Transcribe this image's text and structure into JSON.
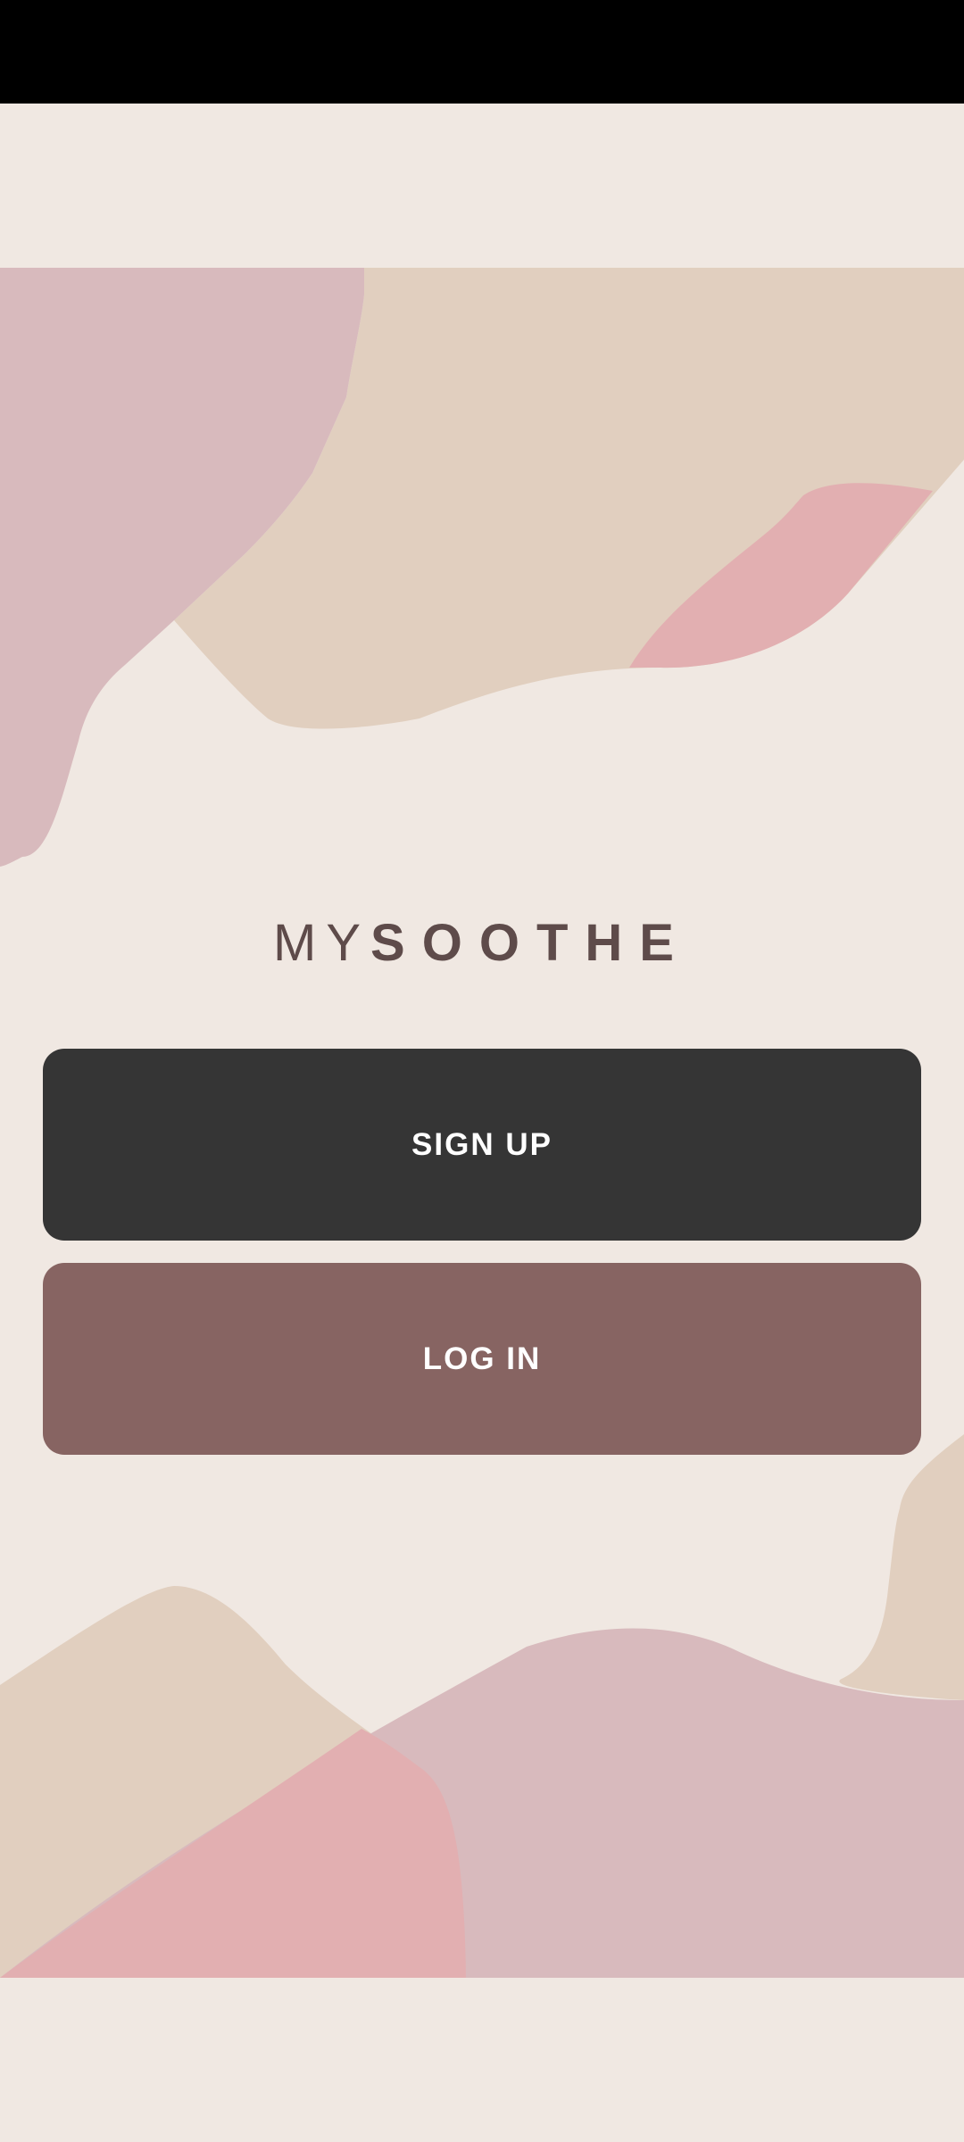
{
  "brand": {
    "prefix": "MY",
    "name": "SOOTHE"
  },
  "actions": {
    "sign_up_label": "SIGN UP",
    "log_in_label": "LOG IN"
  },
  "colors": {
    "background": "#f0e8e2",
    "status_bar": "#000000",
    "sign_up_button": "#353535",
    "log_in_button": "#876462",
    "logo_text": "#5e4b4a",
    "blob_mauve": "#d8babd",
    "blob_sand": "#e1cfbf",
    "blob_pink": "#e2afb1"
  }
}
